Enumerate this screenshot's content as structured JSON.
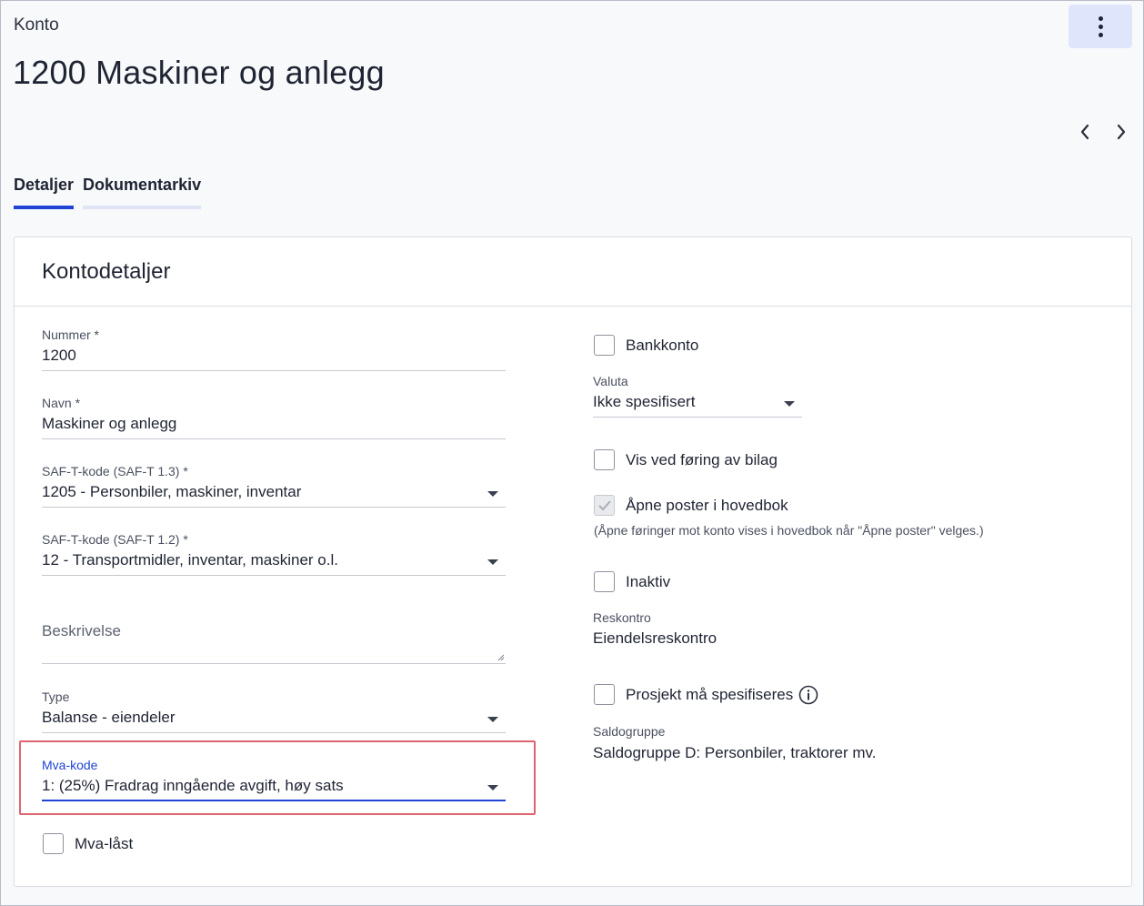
{
  "header": {
    "breadcrumb": "Konto",
    "title": "1200 Maskiner og anlegg",
    "menu_icon": "more-vertical-icon"
  },
  "tabs": [
    {
      "label": "Detaljer",
      "active": true
    },
    {
      "label": "Dokumentarkiv",
      "active": false
    }
  ],
  "card": {
    "title": "Kontodetaljer"
  },
  "left": {
    "nummer": {
      "label": "Nummer *",
      "value": "1200"
    },
    "navn": {
      "label": "Navn *",
      "value": "Maskiner og anlegg"
    },
    "saft13": {
      "label": "SAF-T-kode (SAF-T 1.3) *",
      "value": "1205 - Personbiler, maskiner, inventar"
    },
    "saft12": {
      "label": "SAF-T-kode (SAF-T 1.2) *",
      "value": "12 - Transportmidler, inventar, maskiner o.l."
    },
    "beskrivelse": {
      "placeholder": "Beskrivelse"
    },
    "type": {
      "label": "Type",
      "value": "Balanse - eiendeler"
    },
    "mvakode": {
      "label": "Mva-kode",
      "value": "1: (25%) Fradrag inngående avgift, høy sats"
    },
    "mvalast": {
      "label": "Mva-låst",
      "checked": false
    }
  },
  "right": {
    "bankkonto": {
      "label": "Bankkonto",
      "checked": false
    },
    "valuta": {
      "label": "Valuta",
      "value": "Ikke spesifisert"
    },
    "vis_ved_foring": {
      "label": "Vis ved føring av bilag",
      "checked": false
    },
    "apne_poster": {
      "label": "Åpne poster i hovedbok",
      "checked": true,
      "disabled": true,
      "hint": "(Åpne føringer mot konto vises i hovedbok når \"Åpne poster\" velges.)"
    },
    "inaktiv": {
      "label": "Inaktiv",
      "checked": false
    },
    "reskontro": {
      "label": "Reskontro",
      "value": "Eiendelsreskontro"
    },
    "prosjekt": {
      "label": "Prosjekt må spesifiseres",
      "checked": false
    },
    "saldogruppe": {
      "label": "Saldogruppe",
      "value": "Saldogruppe D: Personbiler, traktorer mv."
    }
  },
  "colors": {
    "accent": "#1f44d6",
    "highlight": "#de6470",
    "menu_bg": "#dfe6fb"
  }
}
